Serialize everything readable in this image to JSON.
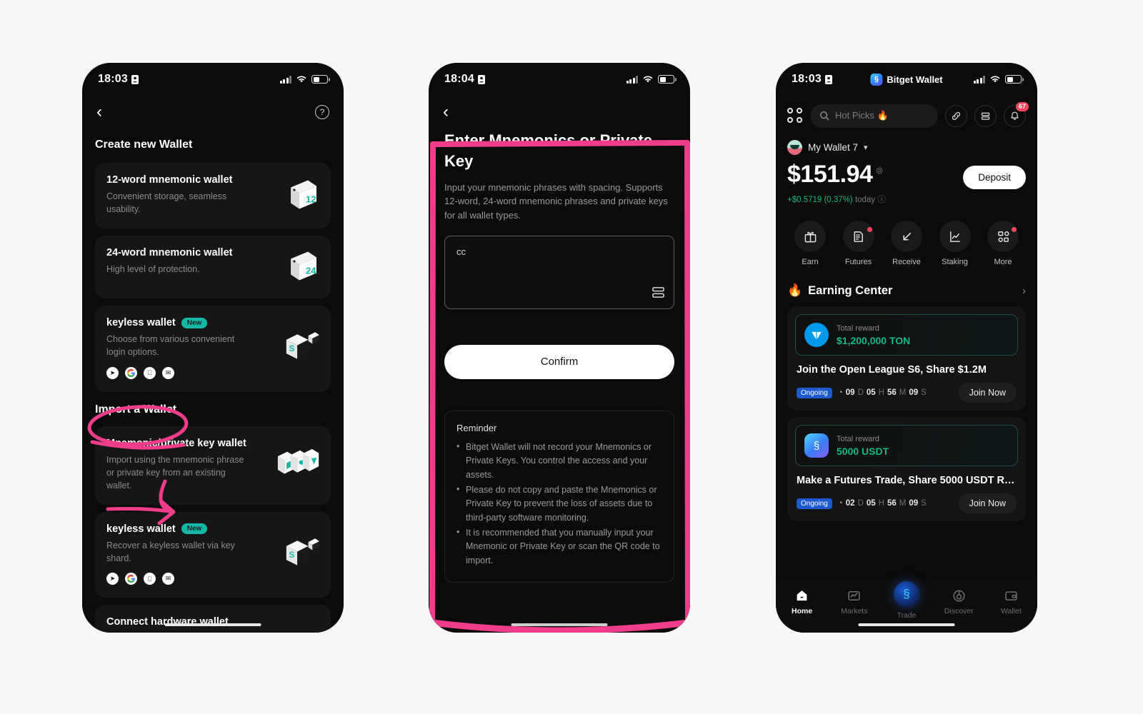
{
  "meta": {
    "accent_pink": "#ef3d8c",
    "accent_teal": "#14b8a6",
    "green": "#12b886"
  },
  "phone1": {
    "status": {
      "time": "18:03",
      "lock_icon": "lock-icon"
    },
    "nav": {
      "back_icon": "chevron-left-icon",
      "help_icon": "help-circle-icon"
    },
    "create_section_title": "Create new Wallet",
    "import_section_title": "Import a Wallet",
    "create_options": [
      {
        "title": "12-word mnemonic wallet",
        "desc": "Convenient storage, seamless usability.",
        "badge": "",
        "art": "book-12-icon"
      },
      {
        "title": "24-word mnemonic wallet",
        "desc": "High level of protection.",
        "badge": "",
        "art": "book-24-icon"
      },
      {
        "title": "keyless wallet",
        "desc": "Choose from various convenient login options.",
        "badge": "New",
        "art": "cube-key-icon",
        "socials": [
          "telegram-icon",
          "google-icon",
          "apple-icon",
          "email-icon"
        ]
      }
    ],
    "import_options": [
      {
        "title": "Mnemonic/private key wallet",
        "desc": "Import using the mnemonic phrase or private key from an existing wallet.",
        "badge": "",
        "art": "cards-icon"
      },
      {
        "title": "keyless wallet",
        "desc": "Recover a keyless wallet via key shard.",
        "badge": "New",
        "art": "cube-key-icon",
        "socials": [
          "telegram-icon",
          "google-icon",
          "apple-icon",
          "email-icon"
        ]
      },
      {
        "title": "Connect hardware wallet",
        "desc": "",
        "badge": "",
        "art": ""
      }
    ]
  },
  "phone2": {
    "status": {
      "time": "18:04",
      "lock_icon": "lock-icon"
    },
    "nav": {
      "back_icon": "chevron-left-icon"
    },
    "title": "Enter Mnemonics or Private Key",
    "subtitle": "Input your mnemonic phrases with spacing. Supports 12-word, 24-word mnemonic phrases and private keys for all wallet types.",
    "input": {
      "value": "cc",
      "placeholder": "",
      "scan_icon": "scan-icon"
    },
    "confirm_label": "Confirm",
    "reminder": {
      "heading": "Reminder",
      "items": [
        "Bitget Wallet will not record your Mnemonics or Private Keys. You control the access and your assets.",
        "Please do not copy and paste the Mnemonics or Private Key to prevent the loss of assets due to third-party software monitoring.",
        "It is recommended that you manually input your Mnemonic or Private Key or scan the QR code to import."
      ]
    }
  },
  "phone3": {
    "status": {
      "time": "18:03",
      "lock_icon": "lock-icon",
      "brand": "Bitget Wallet"
    },
    "topbar": {
      "apps_icon": "grid-apps-icon",
      "search_placeholder": "Hot Picks 🔥",
      "search_icon": "search-icon",
      "link_icon": "link-icon",
      "list_icon": "list-icon",
      "bell_icon": "bell-icon",
      "bell_badge": "67"
    },
    "wallet": {
      "name": "My Wallet 7",
      "chevron_icon": "chevron-down-icon",
      "avatar_icon": "avatar-icon",
      "balance": "$151.94",
      "eye_icon": "eye-icon",
      "change": "+$0.5719 (0.37%)",
      "change_suffix": "today",
      "info_icon": "info-icon",
      "deposit_label": "Deposit"
    },
    "quick_actions": [
      {
        "label": "Earn",
        "icon": "gift-icon",
        "badge": false
      },
      {
        "label": "Futures",
        "icon": "document-icon",
        "badge": true
      },
      {
        "label": "Receive",
        "icon": "arrow-down-left-icon",
        "badge": false
      },
      {
        "label": "Staking",
        "icon": "chart-line-icon",
        "badge": false
      },
      {
        "label": "More",
        "icon": "grid-more-icon",
        "badge": true
      }
    ],
    "earning_center": {
      "title": "Earning Center",
      "fire_icon": "fire-icon",
      "arrow_icon": "chevron-right-icon",
      "cards": [
        {
          "token_icon": "ton-icon",
          "reward_label": "Total reward",
          "reward_value": "$1,200,000 TON",
          "title": "Join the Open League S6, Share $1.2M",
          "status": "Ongoing",
          "clock_icon": "clock-icon",
          "countdown": [
            {
              "n": "09",
              "u": "D"
            },
            {
              "n": "05",
              "u": "H"
            },
            {
              "n": "56",
              "u": "M"
            },
            {
              "n": "09",
              "u": "S"
            }
          ],
          "cta": "Join Now"
        },
        {
          "token_icon": "bitget-icon",
          "reward_label": "Total reward",
          "reward_value": "5000 USDT",
          "title": "Make a Futures Trade, Share 5000 USDT Re...",
          "status": "Ongoing",
          "clock_icon": "clock-icon",
          "countdown": [
            {
              "n": "02",
              "u": "D"
            },
            {
              "n": "05",
              "u": "H"
            },
            {
              "n": "56",
              "u": "M"
            },
            {
              "n": "09",
              "u": "S"
            }
          ],
          "cta": "Join Now"
        }
      ]
    },
    "tabs": [
      {
        "label": "Home",
        "icon": "home-icon",
        "active": true
      },
      {
        "label": "Markets",
        "icon": "markets-icon",
        "active": false
      },
      {
        "label": "Trade",
        "icon": "trade-icon",
        "active": false
      },
      {
        "label": "Discover",
        "icon": "discover-icon",
        "active": false
      },
      {
        "label": "Wallet",
        "icon": "wallet-icon",
        "active": false
      }
    ]
  }
}
